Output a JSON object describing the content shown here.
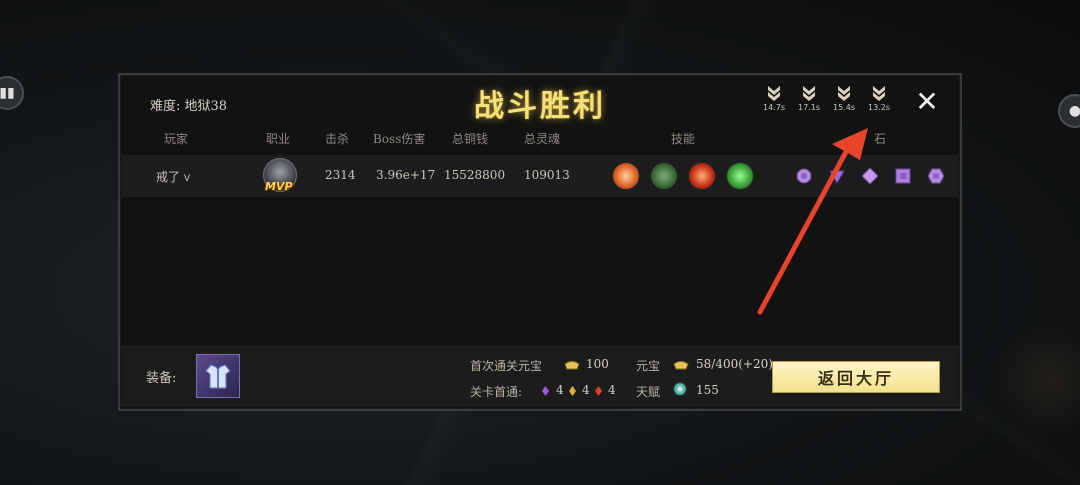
{
  "panel": {
    "difficulty": "难度: 地狱38",
    "title": "战斗胜利",
    "close_glyph": "✕"
  },
  "timers": [
    {
      "time": "14.7s",
      "icon": "rank-chevron-icon"
    },
    {
      "time": "17.1s",
      "icon": "rank-chevron-icon"
    },
    {
      "time": "15.4s",
      "icon": "rank-chevron-icon"
    },
    {
      "time": "13.2s",
      "icon": "rank-chevron-icon"
    }
  ],
  "columns": {
    "player": "玩家",
    "class": "职业",
    "kills": "击杀",
    "boss_damage": "Boss伤害",
    "copper": "总铜钱",
    "souls": "总灵魂",
    "skills": "技能",
    "gems": "石"
  },
  "player_row": {
    "name": "戒了",
    "name_suffix_icon": "chevron-down-icon",
    "mvp": "MVP",
    "kills": "2314",
    "boss_damage": "3.96e+17",
    "copper": "15528800",
    "souls": "109013",
    "skills": [
      {
        "icon": "fire-orb-icon",
        "color": "#e0642a"
      },
      {
        "icon": "poison-orb-icon",
        "color": "#3f6b3a"
      },
      {
        "icon": "flame-burst-icon",
        "color": "#c8321c"
      },
      {
        "icon": "nature-orb-icon",
        "color": "#3aa23a"
      }
    ],
    "gems": [
      {
        "icon": "round-gem-icon",
        "color": "#b58ae0"
      },
      {
        "icon": "triangle-gem-icon",
        "color": "#a06ad8"
      },
      {
        "icon": "diamond-gem-icon",
        "color": "#c79af0"
      },
      {
        "icon": "square-gem-icon",
        "color": "#b07de0"
      },
      {
        "icon": "hexagon-gem-icon",
        "color": "#b58ae0"
      }
    ]
  },
  "footer": {
    "equip_label": "装备:",
    "equip_icon": "armor-icon",
    "first_clear_label": "首次通关元宝",
    "first_clear_value": "100",
    "stage_first_label": "关卡首通:",
    "stage_first_values": [
      "4",
      "4",
      "4"
    ],
    "yuanbao_label": "元宝",
    "yuanbao_value": "58/400(+20)",
    "talent_label": "天赋",
    "talent_value": "155",
    "return_button": "返回大厅"
  },
  "colors": {
    "title": "#f7e07a",
    "arrow": "#e8432b",
    "button_bg": "#f1e08c"
  }
}
